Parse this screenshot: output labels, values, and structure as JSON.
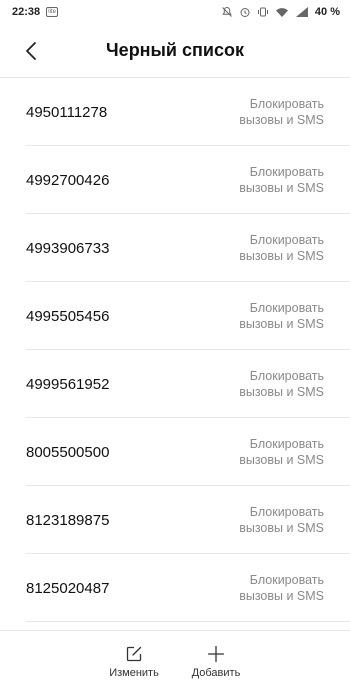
{
  "status_bar": {
    "time": "22:38",
    "notification_icon_text": "lite",
    "battery": "40 %",
    "icons": [
      "mute-icon",
      "alarm-icon",
      "vibrate-icon",
      "wifi-icon",
      "signal-icon",
      "battery-icon"
    ]
  },
  "header": {
    "title": "Черный список",
    "back_icon": "chevron-left-icon"
  },
  "list": {
    "items": [
      {
        "number": "4950111278",
        "action": "Блокировать вызовы и SMS"
      },
      {
        "number": "4992700426",
        "action": "Блокировать вызовы и SMS"
      },
      {
        "number": "4993906733",
        "action": "Блокировать вызовы и SMS"
      },
      {
        "number": "4995505456",
        "action": "Блокировать вызовы и SMS"
      },
      {
        "number": "4999561952",
        "action": "Блокировать вызовы и SMS"
      },
      {
        "number": "8005500500",
        "action": "Блокировать вызовы и SMS"
      },
      {
        "number": "8123189875",
        "action": "Блокировать вызовы и SMS"
      },
      {
        "number": "8125020487",
        "action": "Блокировать вызовы и SMS"
      }
    ]
  },
  "toolbar": {
    "edit_label": "Изменить",
    "add_label": "Добавить",
    "edit_icon": "edit-icon",
    "add_icon": "plus-icon"
  },
  "colors": {
    "text_primary": "#111111",
    "text_secondary": "#8a8a8a",
    "divider": "#e8e8e8",
    "background": "#ffffff"
  }
}
